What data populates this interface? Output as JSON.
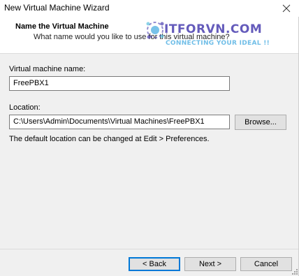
{
  "window": {
    "title": "New Virtual Machine Wizard"
  },
  "header": {
    "title": "Name the Virtual Machine",
    "subtitle": "What name would you like to use for this virtual machine?"
  },
  "watermark": {
    "brand": "ITFORVN.COM",
    "tagline": "CONNECTING YOUR IDEAL !!",
    "colors": {
      "brand": "#4a3fb0",
      "tagline": "#3fa8e0"
    }
  },
  "form": {
    "vm_name_label": "Virtual machine name:",
    "vm_name_value": "FreePBX1",
    "location_label": "Location:",
    "location_value": "C:\\Users\\Admin\\Documents\\Virtual Machines\\FreePBX1",
    "browse_label": "Browse...",
    "hint": "The default location can be changed at Edit > Preferences."
  },
  "footer": {
    "back_label": "< Back",
    "next_label": "Next >",
    "cancel_label": "Cancel"
  },
  "icons": {
    "close": "close-icon",
    "logo": "itforvn-logo-icon",
    "grip": "resize-grip-icon"
  },
  "colors": {
    "dialog_bg": "#f0f0f0",
    "default_button_border": "#0078d7"
  }
}
